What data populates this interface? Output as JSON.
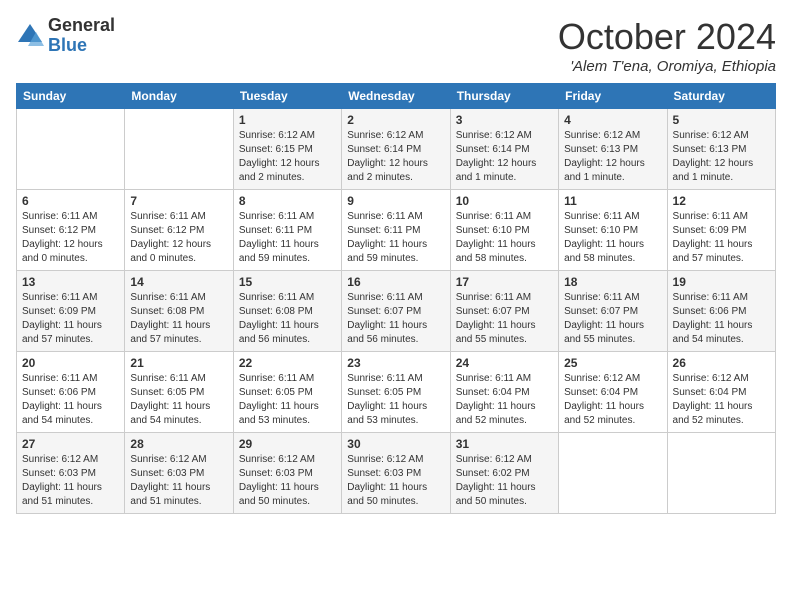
{
  "logo": {
    "general": "General",
    "blue": "Blue"
  },
  "title": "October 2024",
  "location": "'Alem T'ena, Oromiya, Ethiopia",
  "days_of_week": [
    "Sunday",
    "Monday",
    "Tuesday",
    "Wednesday",
    "Thursday",
    "Friday",
    "Saturday"
  ],
  "weeks": [
    [
      {
        "num": "",
        "info": ""
      },
      {
        "num": "",
        "info": ""
      },
      {
        "num": "1",
        "info": "Sunrise: 6:12 AM\nSunset: 6:15 PM\nDaylight: 12 hours and 2 minutes."
      },
      {
        "num": "2",
        "info": "Sunrise: 6:12 AM\nSunset: 6:14 PM\nDaylight: 12 hours and 2 minutes."
      },
      {
        "num": "3",
        "info": "Sunrise: 6:12 AM\nSunset: 6:14 PM\nDaylight: 12 hours and 1 minute."
      },
      {
        "num": "4",
        "info": "Sunrise: 6:12 AM\nSunset: 6:13 PM\nDaylight: 12 hours and 1 minute."
      },
      {
        "num": "5",
        "info": "Sunrise: 6:12 AM\nSunset: 6:13 PM\nDaylight: 12 hours and 1 minute."
      }
    ],
    [
      {
        "num": "6",
        "info": "Sunrise: 6:11 AM\nSunset: 6:12 PM\nDaylight: 12 hours and 0 minutes."
      },
      {
        "num": "7",
        "info": "Sunrise: 6:11 AM\nSunset: 6:12 PM\nDaylight: 12 hours and 0 minutes."
      },
      {
        "num": "8",
        "info": "Sunrise: 6:11 AM\nSunset: 6:11 PM\nDaylight: 11 hours and 59 minutes."
      },
      {
        "num": "9",
        "info": "Sunrise: 6:11 AM\nSunset: 6:11 PM\nDaylight: 11 hours and 59 minutes."
      },
      {
        "num": "10",
        "info": "Sunrise: 6:11 AM\nSunset: 6:10 PM\nDaylight: 11 hours and 58 minutes."
      },
      {
        "num": "11",
        "info": "Sunrise: 6:11 AM\nSunset: 6:10 PM\nDaylight: 11 hours and 58 minutes."
      },
      {
        "num": "12",
        "info": "Sunrise: 6:11 AM\nSunset: 6:09 PM\nDaylight: 11 hours and 57 minutes."
      }
    ],
    [
      {
        "num": "13",
        "info": "Sunrise: 6:11 AM\nSunset: 6:09 PM\nDaylight: 11 hours and 57 minutes."
      },
      {
        "num": "14",
        "info": "Sunrise: 6:11 AM\nSunset: 6:08 PM\nDaylight: 11 hours and 57 minutes."
      },
      {
        "num": "15",
        "info": "Sunrise: 6:11 AM\nSunset: 6:08 PM\nDaylight: 11 hours and 56 minutes."
      },
      {
        "num": "16",
        "info": "Sunrise: 6:11 AM\nSunset: 6:07 PM\nDaylight: 11 hours and 56 minutes."
      },
      {
        "num": "17",
        "info": "Sunrise: 6:11 AM\nSunset: 6:07 PM\nDaylight: 11 hours and 55 minutes."
      },
      {
        "num": "18",
        "info": "Sunrise: 6:11 AM\nSunset: 6:07 PM\nDaylight: 11 hours and 55 minutes."
      },
      {
        "num": "19",
        "info": "Sunrise: 6:11 AM\nSunset: 6:06 PM\nDaylight: 11 hours and 54 minutes."
      }
    ],
    [
      {
        "num": "20",
        "info": "Sunrise: 6:11 AM\nSunset: 6:06 PM\nDaylight: 11 hours and 54 minutes."
      },
      {
        "num": "21",
        "info": "Sunrise: 6:11 AM\nSunset: 6:05 PM\nDaylight: 11 hours and 54 minutes."
      },
      {
        "num": "22",
        "info": "Sunrise: 6:11 AM\nSunset: 6:05 PM\nDaylight: 11 hours and 53 minutes."
      },
      {
        "num": "23",
        "info": "Sunrise: 6:11 AM\nSunset: 6:05 PM\nDaylight: 11 hours and 53 minutes."
      },
      {
        "num": "24",
        "info": "Sunrise: 6:11 AM\nSunset: 6:04 PM\nDaylight: 11 hours and 52 minutes."
      },
      {
        "num": "25",
        "info": "Sunrise: 6:12 AM\nSunset: 6:04 PM\nDaylight: 11 hours and 52 minutes."
      },
      {
        "num": "26",
        "info": "Sunrise: 6:12 AM\nSunset: 6:04 PM\nDaylight: 11 hours and 52 minutes."
      }
    ],
    [
      {
        "num": "27",
        "info": "Sunrise: 6:12 AM\nSunset: 6:03 PM\nDaylight: 11 hours and 51 minutes."
      },
      {
        "num": "28",
        "info": "Sunrise: 6:12 AM\nSunset: 6:03 PM\nDaylight: 11 hours and 51 minutes."
      },
      {
        "num": "29",
        "info": "Sunrise: 6:12 AM\nSunset: 6:03 PM\nDaylight: 11 hours and 50 minutes."
      },
      {
        "num": "30",
        "info": "Sunrise: 6:12 AM\nSunset: 6:03 PM\nDaylight: 11 hours and 50 minutes."
      },
      {
        "num": "31",
        "info": "Sunrise: 6:12 AM\nSunset: 6:02 PM\nDaylight: 11 hours and 50 minutes."
      },
      {
        "num": "",
        "info": ""
      },
      {
        "num": "",
        "info": ""
      }
    ]
  ]
}
